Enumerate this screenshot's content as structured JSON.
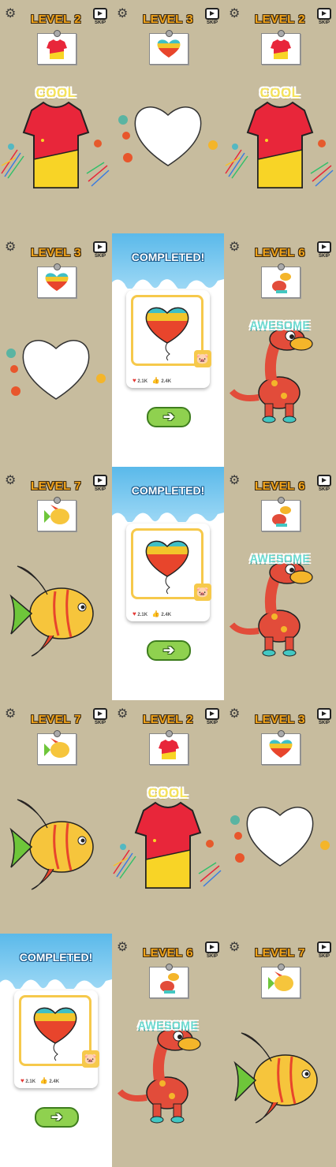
{
  "screens": [
    {
      "kind": "level",
      "title": "LEVEL 2",
      "art": "shirt",
      "praise": "COOL"
    },
    {
      "kind": "level",
      "title": "LEVEL 3",
      "art": "heart-blank",
      "praise": ""
    },
    {
      "kind": "level",
      "title": "LEVEL 2",
      "art": "shirt",
      "praise": "COOL"
    },
    {
      "kind": "level",
      "title": "LEVEL 3",
      "art": "heart-blank",
      "praise": ""
    },
    {
      "kind": "completed",
      "title": "COMPLETED!",
      "likes": "2.1K",
      "thumbs": "2.4K"
    },
    {
      "kind": "level",
      "title": "LEVEL 6",
      "art": "dino",
      "praise": "AWESOME"
    },
    {
      "kind": "level",
      "title": "LEVEL 7",
      "art": "fish",
      "praise": ""
    },
    {
      "kind": "completed",
      "title": "COMPLETED!",
      "likes": "2.1K",
      "thumbs": "2.4K"
    },
    {
      "kind": "level",
      "title": "LEVEL 6",
      "art": "dino",
      "praise": "AWESOME"
    },
    {
      "kind": "level",
      "title": "LEVEL 7",
      "art": "fish",
      "praise": ""
    },
    {
      "kind": "level",
      "title": "LEVEL 2",
      "art": "shirt",
      "praise": "COOL"
    },
    {
      "kind": "level",
      "title": "LEVEL 3",
      "art": "heart-blank",
      "praise": ""
    },
    {
      "kind": "completed",
      "title": "COMPLETED!",
      "likes": "2.1K",
      "thumbs": "2.4K"
    },
    {
      "kind": "level",
      "title": "LEVEL 6",
      "art": "dino",
      "praise": "AWESOME"
    },
    {
      "kind": "level",
      "title": "LEVEL 7",
      "art": "fish",
      "praise": ""
    }
  ],
  "ui": {
    "skip_label": "SKIP",
    "settings_icon": "gear-icon",
    "skip_icon": "video-ad-icon",
    "next_icon": "arrow-right-icon",
    "next_glyph": "➔",
    "like_glyph": "♥",
    "thumb_glyph": "👍"
  },
  "colors": {
    "background": "#c7bc9e",
    "level_title": "#f3a51b",
    "cool_text": "#f6e35a",
    "awesome_text": "#69d9d0",
    "next_button": "#8fd14f",
    "sky": "#5ab9ea"
  }
}
